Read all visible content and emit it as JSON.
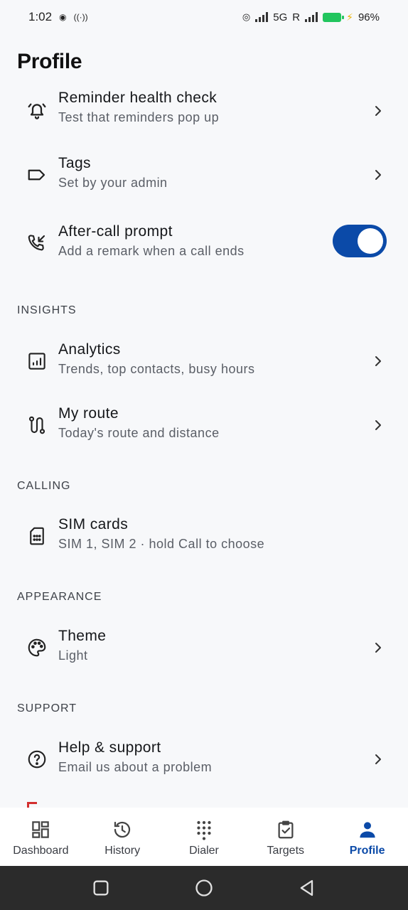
{
  "status": {
    "time": "1:02",
    "network": "5G",
    "roaming": "R",
    "battery": "96%"
  },
  "page": {
    "title": "Profile"
  },
  "rows": {
    "reminder": {
      "title": "Reminder health check",
      "sub": "Test that reminders pop up"
    },
    "tags": {
      "title": "Tags",
      "sub": "Set by your admin"
    },
    "aftercall": {
      "title": "After-call prompt",
      "sub": "Add a remark when a call ends",
      "enabled": true
    },
    "analytics": {
      "title": "Analytics",
      "sub": "Trends, top contacts, busy hours"
    },
    "route": {
      "title": "My route",
      "sub": "Today's route and distance"
    },
    "sim": {
      "title": "SIM cards",
      "sub": "SIM 1, SIM 2 · hold Call to choose"
    },
    "theme": {
      "title": "Theme",
      "sub": "Light"
    },
    "help": {
      "title": "Help & support",
      "sub": "Email us about a problem"
    }
  },
  "sections": {
    "insights": "INSIGHTS",
    "calling": "CALLING",
    "appearance": "APPEARANCE",
    "support": "SUPPORT"
  },
  "nav": {
    "dashboard": "Dashboard",
    "history": "History",
    "dialer": "Dialer",
    "targets": "Targets",
    "profile": "Profile",
    "active": "profile"
  },
  "colors": {
    "accent": "#0b4aa8",
    "background": "#f7f8fa",
    "battery": "#22c55e",
    "danger": "#d32f2f"
  }
}
